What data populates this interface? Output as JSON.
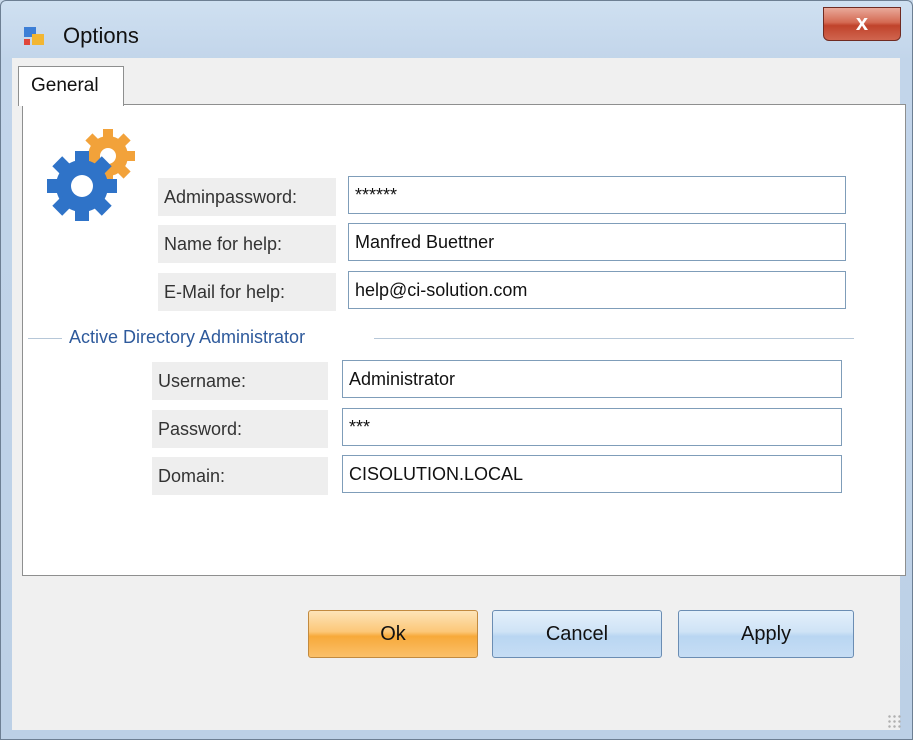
{
  "window": {
    "title": "Options",
    "close_glyph": "x"
  },
  "tabs": [
    {
      "label": "General"
    }
  ],
  "general": {
    "fields": [
      {
        "label": "Adminpassword:",
        "value": "******"
      },
      {
        "label": "Name for help:",
        "value": "Manfred Buettner"
      },
      {
        "label": "E-Mail for help:",
        "value": "help@ci-solution.com"
      }
    ],
    "ad_group": {
      "title": "Active Directory Administrator",
      "fields": [
        {
          "label": "Username:",
          "value": "Administrator"
        },
        {
          "label": "Password:",
          "value": "***"
        },
        {
          "label": "Domain:",
          "value": "CISOLUTION.LOCAL"
        }
      ]
    }
  },
  "buttons": {
    "ok": "Ok",
    "cancel": "Cancel",
    "apply": "Apply"
  },
  "icons": {
    "app": "options-app-icon",
    "settings": "gear-icon",
    "close": "close-icon"
  },
  "colors": {
    "ok_button": "#fcc778",
    "group_title": "#2e5a9c",
    "close_button": "#c0432b"
  }
}
